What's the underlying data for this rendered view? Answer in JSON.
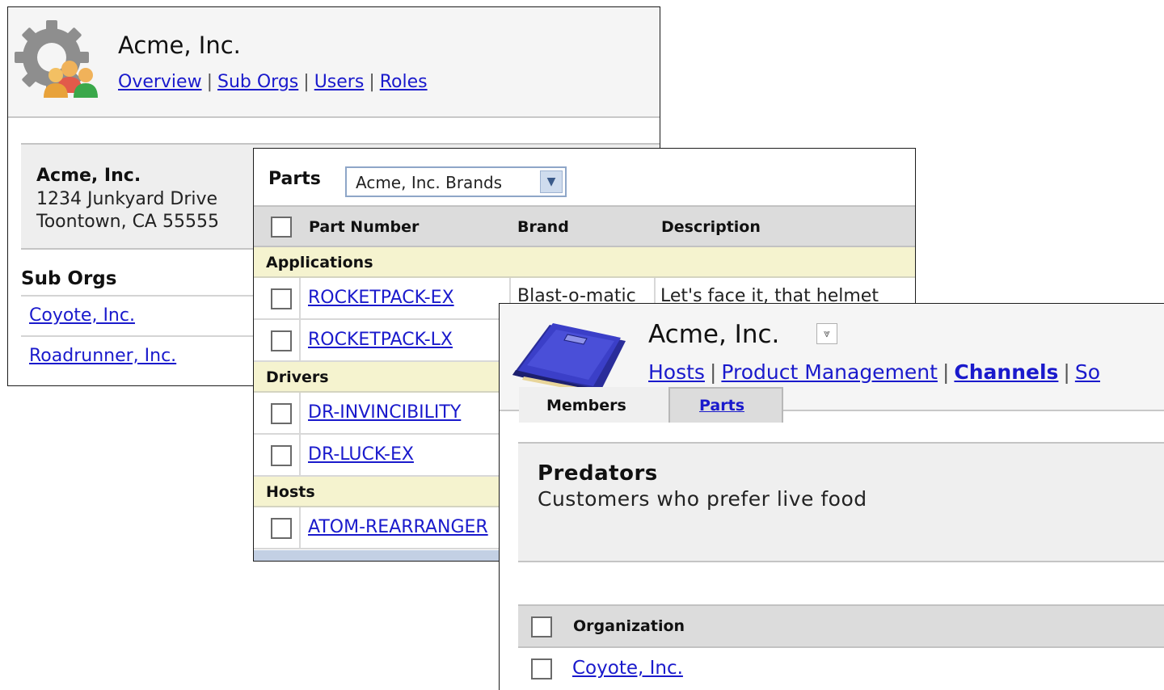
{
  "org_window": {
    "title": "Acme, Inc.",
    "nav": [
      "Overview",
      "Sub Orgs",
      "Users",
      "Roles"
    ],
    "nav_separator": "|",
    "address": {
      "name": "Acme, Inc.",
      "line1": "1234 Junkyard Drive",
      "line2": "Toontown, CA 55555"
    },
    "sub_orgs_heading": "Sub Orgs",
    "sub_orgs": [
      "Coyote, Inc.",
      "Roadrunner, Inc."
    ],
    "icon": "gear-users-icon"
  },
  "parts_window": {
    "title": "Parts",
    "brand_select": {
      "value": "Acme, Inc. Brands",
      "icon": "chevron-down-icon"
    },
    "columns": [
      "Part Number",
      "Brand",
      "Description"
    ],
    "groups": [
      {
        "name": "Applications",
        "parts": [
          {
            "number": "ROCKETPACK-EX",
            "brand": "Blast-o-matic",
            "description": "Let's face it, that helmet"
          },
          {
            "number": "ROCKETPACK-LX",
            "brand": "",
            "description": ""
          }
        ]
      },
      {
        "name": "Drivers",
        "parts": [
          {
            "number": "DR-INVINCIBILITY",
            "brand": "",
            "description": ""
          },
          {
            "number": "DR-LUCK-EX",
            "brand": "",
            "description": ""
          }
        ]
      },
      {
        "name": "Hosts",
        "parts": [
          {
            "number": "ATOM-REARRANGER",
            "brand": "",
            "description": ""
          }
        ]
      }
    ]
  },
  "host_window": {
    "title": "Acme, Inc.",
    "menu_icon": "double-chevron-down-icon",
    "nav": [
      "Hosts",
      "Product Management",
      "Channels",
      "So"
    ],
    "nav_current": "Channels",
    "nav_separator": "|",
    "channel": {
      "name": "Predators",
      "description": "Customers who prefer live food"
    },
    "tabs": [
      "Members",
      "Parts"
    ],
    "active_tab": "Members",
    "table_header": "Organization",
    "rows": [
      "Coyote, Inc."
    ],
    "icon": "blue-drive-icon",
    "colors": {
      "drive": "#3b3fc8",
      "link": "#1a1acc"
    }
  }
}
